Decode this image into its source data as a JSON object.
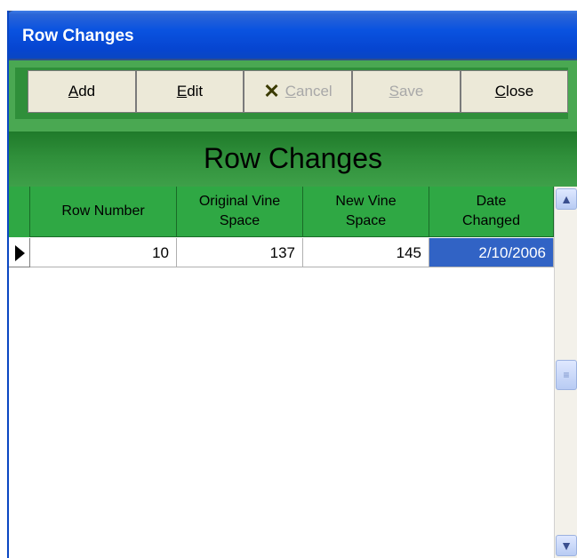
{
  "window": {
    "title": "Row Changes"
  },
  "toolbar": {
    "add": {
      "prefix": "",
      "hot": "A",
      "rest": "dd"
    },
    "edit": {
      "prefix": "",
      "hot": "E",
      "rest": "dit"
    },
    "cancel": {
      "prefix": "",
      "hot": "C",
      "rest": "ancel",
      "icon": "cancel-x-icon"
    },
    "save": {
      "prefix": "",
      "hot": "S",
      "rest": "ave"
    },
    "close": {
      "prefix": "",
      "hot": "C",
      "rest": "lose"
    }
  },
  "form": {
    "heading": "Row Changes"
  },
  "grid": {
    "columns": [
      "Row Number",
      "Original Vine Space",
      "New Vine Space",
      "Date Changed"
    ],
    "rows": [
      {
        "row_number": "10",
        "original": "137",
        "new": "145",
        "date": "2/10/2006"
      }
    ]
  },
  "colors": {
    "titlebar": "#0a53e0",
    "header_green": "#2fa844",
    "selection": "#3163c5"
  }
}
